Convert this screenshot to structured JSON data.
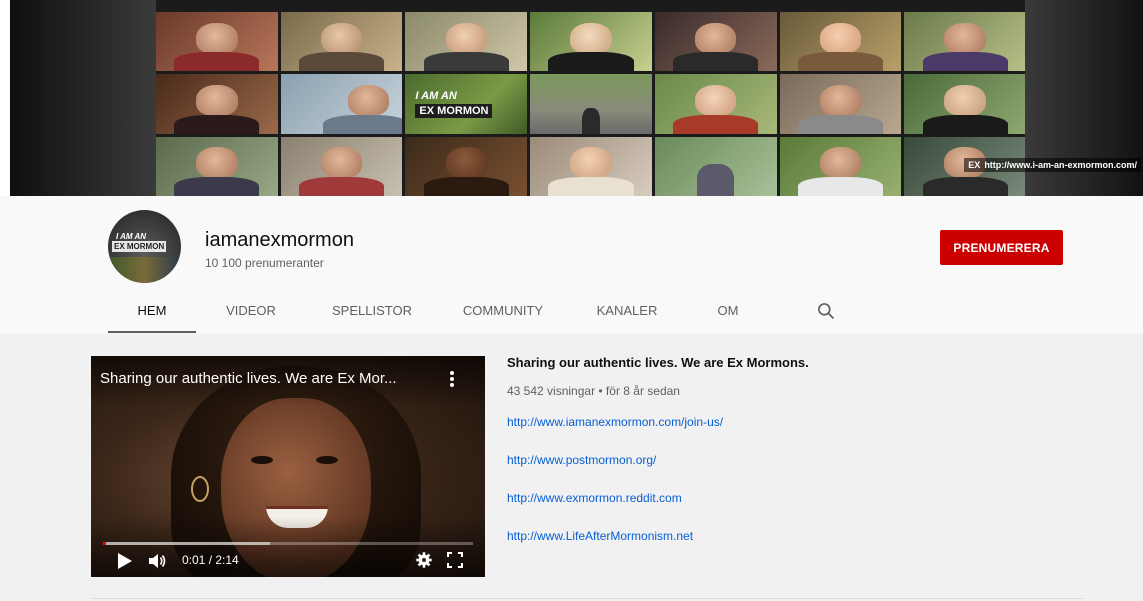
{
  "banner": {
    "logo_line1": "I AM AN",
    "logo_line2": "EX MORMON",
    "url_badge": "EX",
    "url_text": "http://www.i-am-an-exmormon.com/"
  },
  "channel": {
    "name": "iamanexmormon",
    "subscribers": "10 100 prenumeranter",
    "subscribe_label": "PRENUMERERA",
    "avatar_line1": "I AM AN",
    "avatar_line2": "EX MORMON",
    "subscribe_color": "#cc0000"
  },
  "tabs": [
    {
      "label": "HEM",
      "active": true
    },
    {
      "label": "VIDEOR",
      "active": false
    },
    {
      "label": "SPELLISTOR",
      "active": false
    },
    {
      "label": "COMMUNITY",
      "active": false
    },
    {
      "label": "KANALER",
      "active": false
    },
    {
      "label": "OM",
      "active": false
    }
  ],
  "player": {
    "title": "Sharing our authentic lives. We are Ex Mor...",
    "time": "0:01 / 2:14",
    "played_fraction": 0.008,
    "buffered_fraction": 0.45
  },
  "featured": {
    "title": "Sharing our authentic lives. We are Ex Mormons.",
    "meta": "43 542 visningar • för 8 år sedan",
    "links": [
      "http://www.iamanexmormon.com/join-us/",
      "http://www.postmormon.org/",
      "http://www.exmormon.reddit.com",
      "http://www.LifeAfterMormonism.net"
    ],
    "link_color": "#065fd4"
  }
}
